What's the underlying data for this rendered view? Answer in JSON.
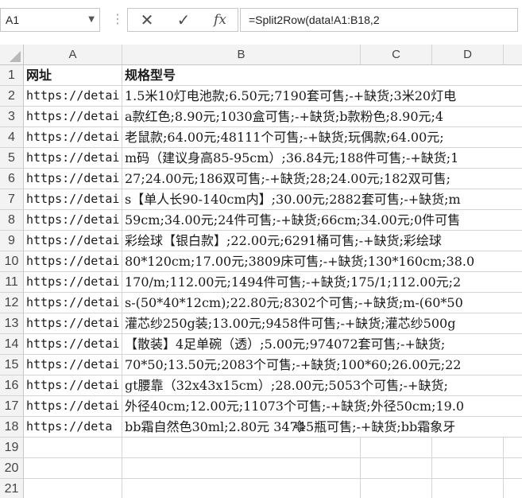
{
  "formula_bar": {
    "name_box": "A1",
    "name_box_dropdown_icon": "chevron-down-icon",
    "cancel_icon": "close-icon",
    "enter_icon": "checkmark-icon",
    "fx_label": "fx",
    "formula": "=Split2Row(data!A1:B18,2"
  },
  "columns": [
    "A",
    "B",
    "C",
    "D"
  ],
  "rows": [
    {
      "n": "1",
      "a": "网址",
      "b": "规格型号",
      "header": true
    },
    {
      "n": "2",
      "a": "https://detai",
      "b": "1.5米10灯电池款;6.50元;7190套可售;-+缺货;3米20灯电"
    },
    {
      "n": "3",
      "a": "https://detai",
      "b": "a款红色;8.90元;1030盒可售;-+缺货;b款粉色;8.90元;4"
    },
    {
      "n": "4",
      "a": "https://detai",
      "b": "老鼠款;64.00元;48111个可售;-+缺货;玩偶款;64.00元;"
    },
    {
      "n": "5",
      "a": "https://detai",
      "b": "m码（建议身高85-95cm）;36.84元;188件可售;-+缺货;1"
    },
    {
      "n": "6",
      "a": "https://detai",
      "b": "27;24.00元;186双可售;-+缺货;28;24.00元;182双可售;"
    },
    {
      "n": "7",
      "a": "https://detai",
      "b": "s【单人长90-140cm内】;30.00元;2882套可售;-+缺货;m"
    },
    {
      "n": "8",
      "a": "https://detai",
      "b": "59cm;34.00元;24件可售;-+缺货;66cm;34.00元;0件可售"
    },
    {
      "n": "9",
      "a": "https://detai",
      "b": "彩绘球【银白款】;22.00元;6291桶可售;-+缺货;彩绘球"
    },
    {
      "n": "10",
      "a": "https://detai",
      "b": "80*120cm;17.00元;3809床可售;-+缺货;130*160cm;38.0"
    },
    {
      "n": "11",
      "a": "https://detai",
      "b": "170/m;112.00元;1494件可售;-+缺货;175/1;112.00元;2"
    },
    {
      "n": "12",
      "a": "https://detai",
      "b": "s-(50*40*12cm);22.80元;8302个可售;-+缺货;m-(60*50"
    },
    {
      "n": "13",
      "a": "https://detai",
      "b": "灌芯纱250g装;13.00元;9458件可售;-+缺货;灌芯纱500g"
    },
    {
      "n": "14",
      "a": "https://detai",
      "b": "【散装】4足单碗（透）;5.00元;974072套可售;-+缺货;"
    },
    {
      "n": "15",
      "a": "https://detai",
      "b": "70*50;13.50元;2083个可售;-+缺货;100*60;26.00元;22"
    },
    {
      "n": "16",
      "a": "https://detai",
      "b": "gt腰靠（32x43x15cm）;28.00元;5053个可售;-+缺货;"
    },
    {
      "n": "17",
      "a": "https://detai",
      "b": "外径40cm;12.00元;11073个可售;-+缺货;外径50cm;19.0"
    },
    {
      "n": "18",
      "a": "https://deta",
      "b": "bb霜自然色30ml;2.80元 34745瓶可售;-+缺货;bb霜象牙"
    },
    {
      "n": "19",
      "a": "",
      "b": ""
    },
    {
      "n": "20",
      "a": "",
      "b": ""
    },
    {
      "n": "21",
      "a": "",
      "b": ""
    }
  ],
  "cursor_icon": "move-crosshair-icon",
  "colors": {
    "header_bg": "#f3f3f3",
    "gridline": "#d4d4d4",
    "text": "#1a1a1a"
  }
}
